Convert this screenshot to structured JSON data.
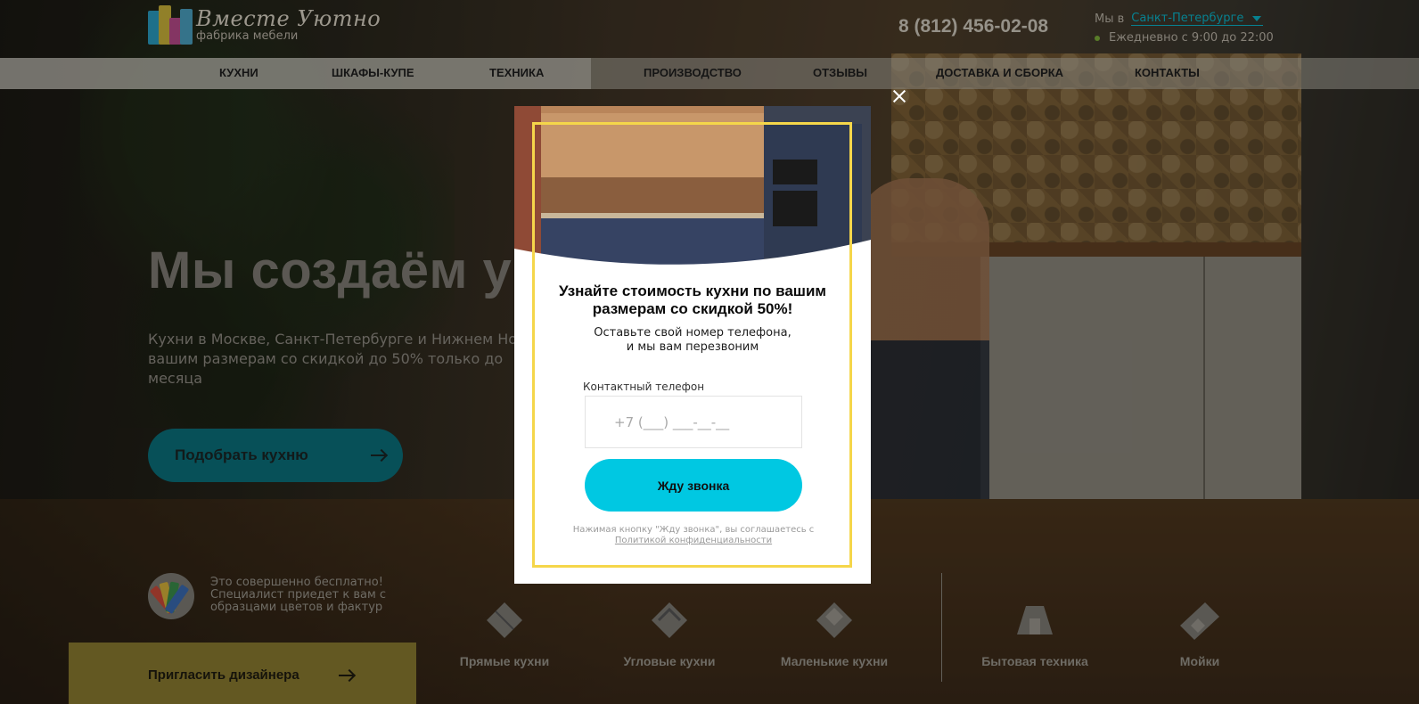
{
  "logo": {
    "name": "Вместе Уютно",
    "subtitle": "фабрика мебели"
  },
  "header": {
    "phone": "8 (812) 456-02-08",
    "city_prefix": "Мы в",
    "city": "Санкт-Петербурге",
    "hours": "Ежедневно с 9:00 до 22:00"
  },
  "nav": {
    "items": [
      {
        "label": "КУХНИ"
      },
      {
        "label": "ШКАФЫ-КУПЕ"
      },
      {
        "label": "ТЕХНИКА"
      },
      {
        "label": "ПРОИЗВОДСТВО"
      },
      {
        "label": "ОТЗЫВЫ"
      },
      {
        "label": "ДОСТАВКА И СБОРКА"
      },
      {
        "label": "КОНТАКТЫ"
      }
    ]
  },
  "hero": {
    "title": "Мы создаём у                       е",
    "subtitle": "Кухни в Москве, Санкт-Петербурге и Нижнем Но по вашим размерам со скидкой до 50% только до месяца",
    "cta_label": "Подобрать кухню",
    "free_text": "Это совершенно бесплатно! Специалист приедет к вам с образцами цветов и фактур",
    "designer_label": "Пригласить дизайнера"
  },
  "categories": [
    {
      "label": "Прямые кухни",
      "icon": "straight-kitchen-icon"
    },
    {
      "label": "Угловые кухни",
      "icon": "corner-kitchen-icon"
    },
    {
      "label": "Маленькие кухни",
      "icon": "small-kitchen-icon"
    },
    {
      "label": "Бытовая техника",
      "icon": "appliances-icon"
    },
    {
      "label": "Мойки",
      "icon": "sink-icon"
    }
  ],
  "modal": {
    "title": "Узнайте стоимость кухни по вашим размерам со скидкой 50%!",
    "subtitle_line1": "Оставьте свой номер телефона,",
    "subtitle_line2": "и мы вам перезвоним",
    "phone_label": "Контактный телефон",
    "phone_placeholder": "+7 (___) ___-__-__",
    "submit_label": "Жду звонка",
    "legal_text": "Нажимая кнопку \"Жду звонка\", вы соглашаетесь с",
    "legal_link": "Политикой конфиденциальности"
  },
  "colors": {
    "accent_cyan": "#00c8e2",
    "frame_yellow": "#f5d64a",
    "city_link": "#0bb3c8",
    "designer_bar": "#8a7a30"
  }
}
